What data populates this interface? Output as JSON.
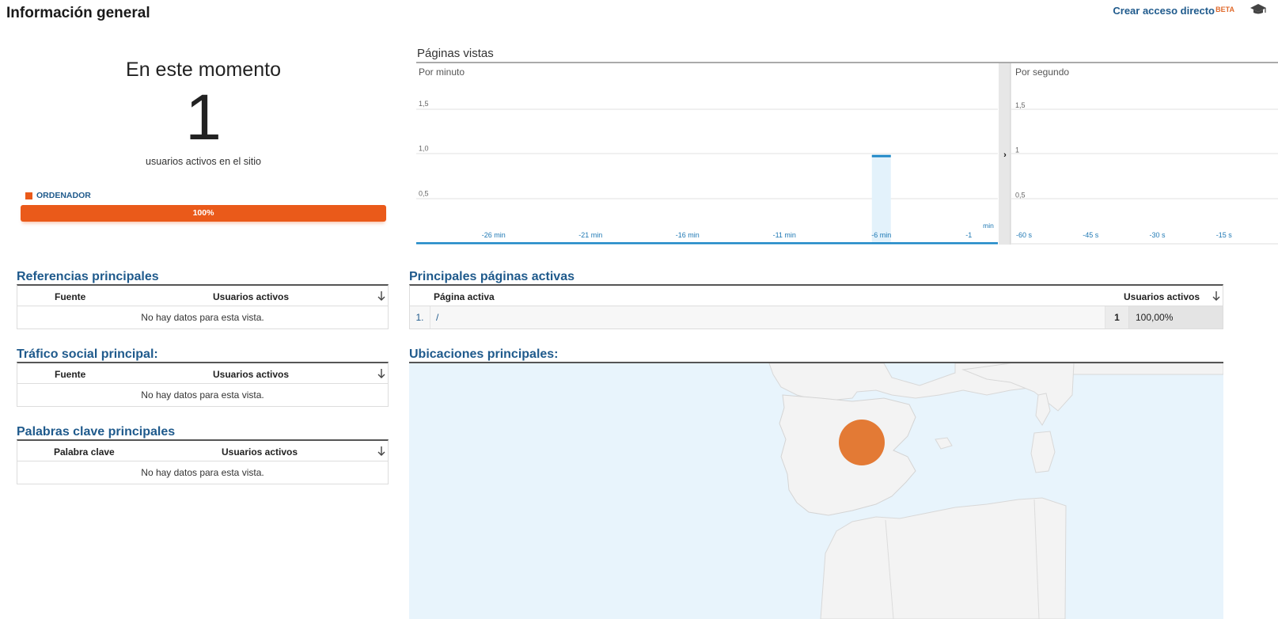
{
  "header": {
    "title": "Información general",
    "shortcut_label": "Crear acceso directo",
    "beta_label": "BETA"
  },
  "now": {
    "title": "En este momento",
    "count": "1",
    "subtitle": "usuarios activos en el sitio",
    "device_label": "ORDENADOR",
    "device_percent_label": "100%",
    "device_share": 1.0,
    "device_color": "#ea5a1a"
  },
  "pageviews": {
    "title": "Páginas vistas",
    "per_minute_label": "Por minuto",
    "per_second_label": "Por segundo"
  },
  "chart_data": [
    {
      "type": "bar",
      "title": "Por minuto",
      "x_tick_labels": [
        "-26 min",
        "-21 min",
        "-16 min",
        "-11 min",
        "-6 min",
        "-1"
      ],
      "x_unit_label": "min",
      "y_tick_labels": [
        "0,5",
        "1,0",
        "1,5"
      ],
      "ylim": [
        0,
        2
      ],
      "x": [
        -6
      ],
      "values": [
        1
      ],
      "bar_color": "#1e88c7",
      "highlight_color": "#e3f2fb"
    },
    {
      "type": "bar",
      "title": "Por segundo",
      "x_tick_labels": [
        "-60 s",
        "-45 s",
        "-30 s",
        "-15 s"
      ],
      "y_tick_labels": [
        "0,5",
        "1",
        "1,5"
      ],
      "ylim": [
        0,
        2
      ],
      "values": []
    }
  ],
  "referrals": {
    "title": "Referencias principales",
    "col1": "Fuente",
    "col2": "Usuarios activos",
    "empty": "No hay datos para esta vista."
  },
  "social": {
    "title": "Tráfico social principal:",
    "col1": "Fuente",
    "col2": "Usuarios activos",
    "empty": "No hay datos para esta vista."
  },
  "keywords": {
    "title": "Palabras clave principales",
    "col1": "Palabra clave",
    "col2": "Usuarios activos",
    "empty": "No hay datos para esta vista."
  },
  "active_pages": {
    "title": "Principales páginas activas",
    "col1": "Página activa",
    "col2": "Usuarios activos",
    "rows": [
      {
        "index": "1.",
        "path": "/",
        "users": "1",
        "percent": "100,00%"
      }
    ]
  },
  "locations": {
    "title": "Ubicaciones principales:",
    "marker_color": "#e37a35"
  },
  "colors": {
    "accent": "#1f5a8c",
    "orange": "#ea5a1a"
  }
}
